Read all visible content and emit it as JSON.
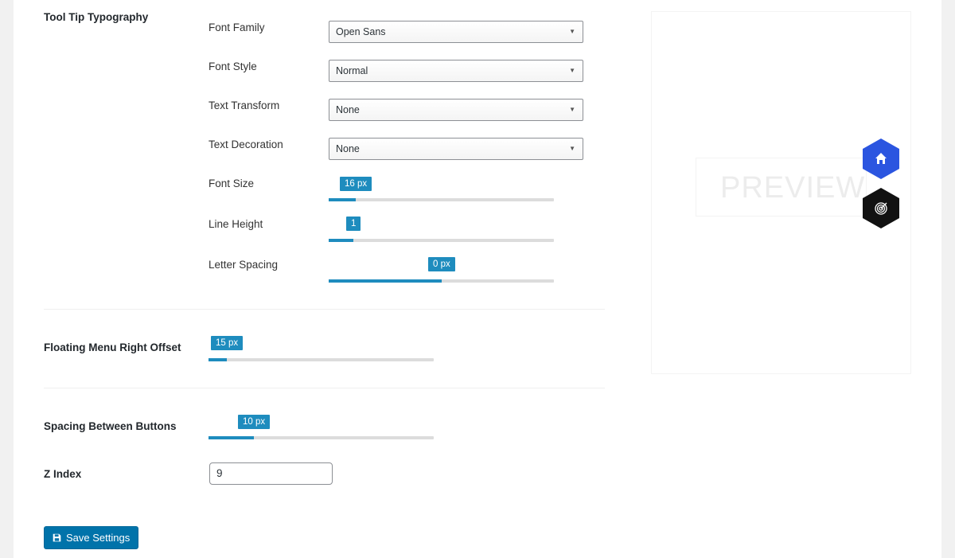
{
  "tooltip_typography": {
    "title": "Tool Tip Typography",
    "font_family": {
      "label": "Font Family",
      "value": "Open Sans"
    },
    "font_style": {
      "label": "Font Style",
      "value": "Normal"
    },
    "text_transform": {
      "label": "Text Transform",
      "value": "None"
    },
    "text_decoration": {
      "label": "Text Decoration",
      "value": "None"
    },
    "font_size": {
      "label": "Font Size",
      "value": "16 px",
      "fill_fraction": 0.12
    },
    "line_height": {
      "label": "Line Height",
      "value": "1",
      "fill_fraction": 0.11
    },
    "letter_spacing": {
      "label": "Letter Spacing",
      "value": "0 px",
      "fill_fraction": 0.5
    }
  },
  "right_offset": {
    "label": "Floating Menu Right Offset",
    "value": "15 px",
    "fill_fraction": 0.08
  },
  "button_spacing": {
    "label": "Spacing Between Buttons",
    "value": "10 px",
    "fill_fraction": 0.2
  },
  "z_index": {
    "label": "Z Index",
    "value": "9"
  },
  "save_button": {
    "label": "Save Settings",
    "icon": "save-icon"
  },
  "preview": {
    "text": "PREVIEW",
    "buttons": [
      {
        "icon": "home-icon",
        "color": "#2b55e0"
      },
      {
        "icon": "target-icon",
        "color": "#111111"
      }
    ]
  },
  "colors": {
    "accent": "#1e8cbe",
    "button": "#0073aa"
  }
}
